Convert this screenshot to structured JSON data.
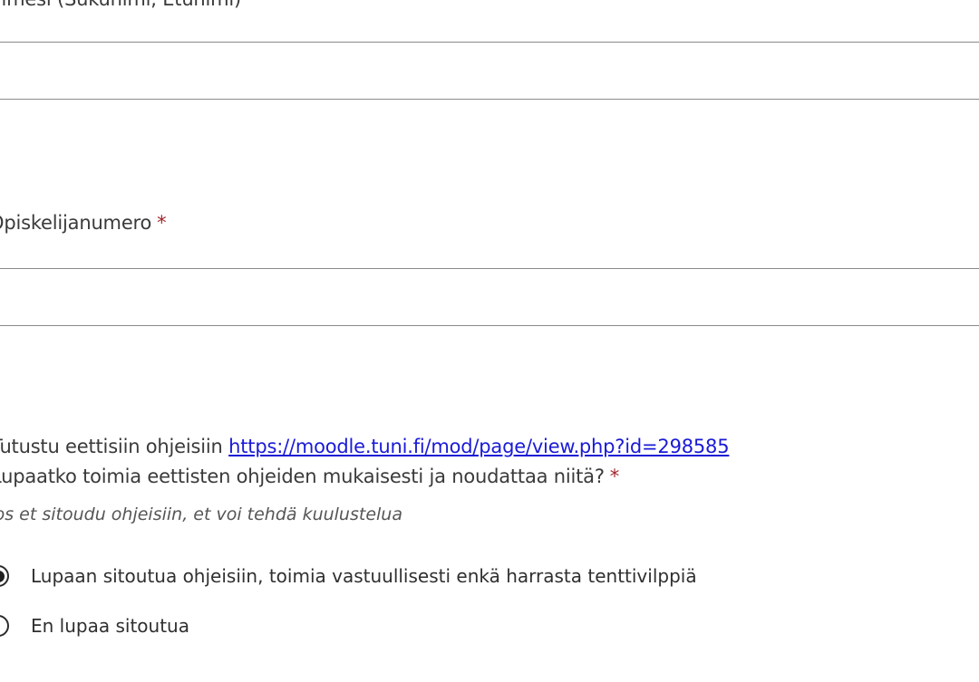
{
  "form": {
    "name_question": {
      "label": "Nimesi (Sukunimi, Etunimi)",
      "value": ""
    },
    "student_number_question": {
      "label": "Opiskelijanumero",
      "required_mark": "*",
      "value": ""
    },
    "ethics_question": {
      "intro_text": "Tutustu eettisiin ohjeisiin ",
      "link_text": "https://moodle.tuni.fi/mod/page/view.php?id=298585",
      "question_text": "Lupaatko toimia eettisten ohjeiden mukaisesti ja noudattaa niitä?",
      "required_mark": "*",
      "hint": "Jos et sitoudu ohjeisiin, et voi tehdä kuulustelua",
      "options": [
        {
          "label": "Lupaan sitoutua ohjeisiin, toimia vastuullisesti enkä harrasta tenttivilppiä",
          "selected": true
        },
        {
          "label": "En lupaa sitoutua",
          "selected": false
        }
      ]
    }
  }
}
